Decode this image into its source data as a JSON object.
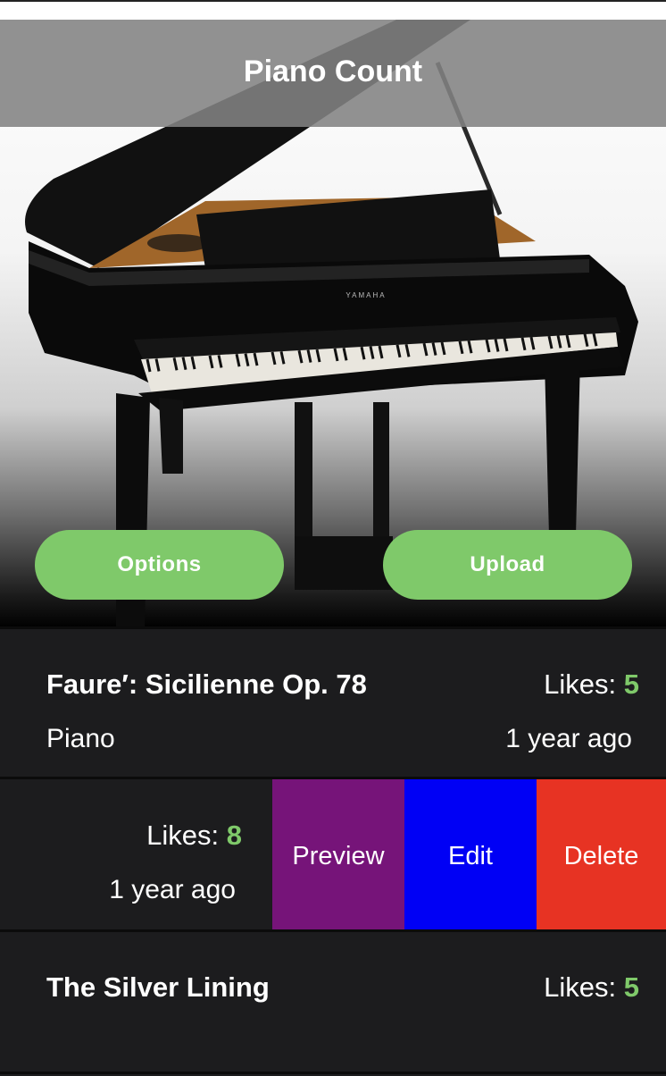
{
  "header": {
    "title": "Piano Count"
  },
  "hero": {
    "brand_label": "YAMAHA"
  },
  "buttons": {
    "options": "Options",
    "upload": "Upload"
  },
  "likes_label": "Likes: ",
  "items": [
    {
      "title": "Faure′: Sicilienne Op. 78",
      "subtitle": "Piano",
      "likes": "5",
      "time": "1 year ago"
    },
    {
      "title": "",
      "subtitle": "",
      "likes": "8",
      "time": "1 year ago"
    },
    {
      "title": "The Silver Lining",
      "subtitle": "",
      "likes": "5",
      "time": ""
    }
  ],
  "swipe_actions": {
    "preview": "Preview",
    "edit": "Edit",
    "delete": "Delete"
  },
  "colors": {
    "accent_green": "#7fc96a",
    "preview": "#761479",
    "edit": "#0000f5",
    "delete": "#e73323",
    "row_bg": "#1c1c1e"
  }
}
